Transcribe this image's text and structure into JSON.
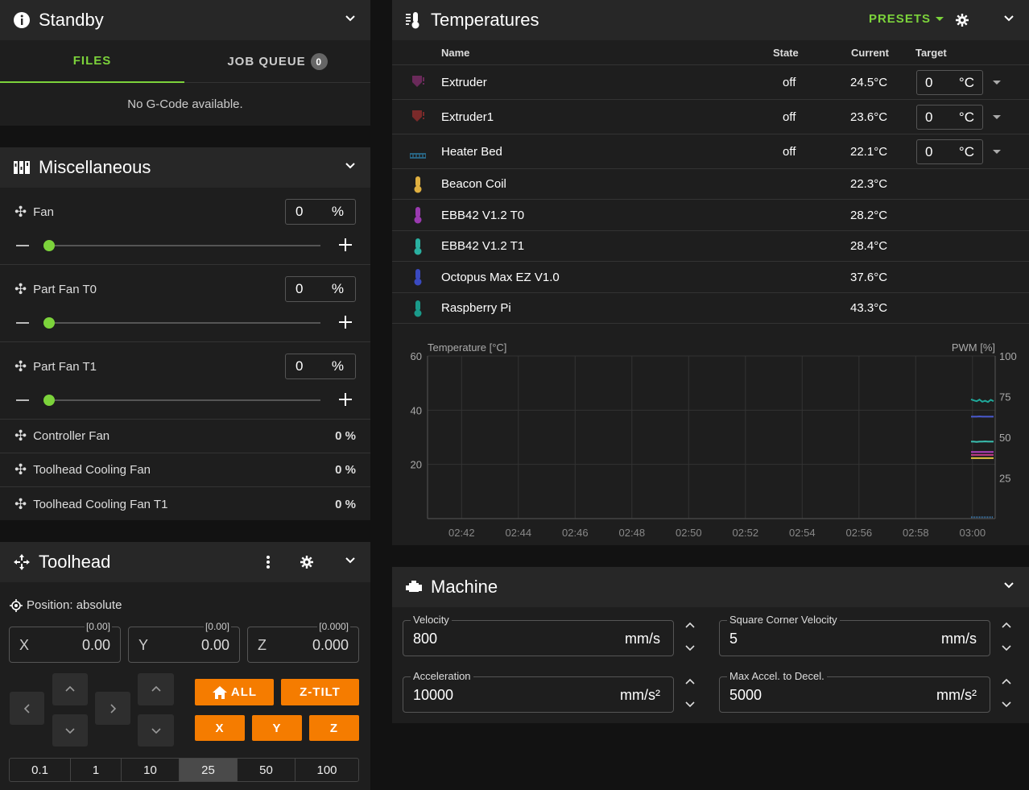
{
  "standby": {
    "title": "Standby",
    "tabs": [
      {
        "label": "FILES"
      },
      {
        "label": "JOB QUEUE",
        "badge": "0"
      }
    ],
    "empty_msg": "No G-Code available."
  },
  "misc": {
    "title": "Miscellaneous",
    "fans": [
      {
        "label": "Fan",
        "value": "0",
        "unit": "%",
        "level": 0
      },
      {
        "label": "Part Fan T0",
        "value": "0",
        "unit": "%",
        "level": 0
      },
      {
        "label": "Part Fan T1",
        "value": "0",
        "unit": "%",
        "level": 0
      }
    ],
    "status_fans": [
      {
        "label": "Controller Fan",
        "value": "0 %"
      },
      {
        "label": "Toolhead Cooling Fan",
        "value": "0 %"
      },
      {
        "label": "Toolhead Cooling Fan T1",
        "value": "0 %"
      }
    ]
  },
  "toolhead": {
    "title": "Toolhead",
    "position_label": "Position: absolute",
    "axes": [
      {
        "label": "X",
        "value": "0.00",
        "bracket": "[0.00]"
      },
      {
        "label": "Y",
        "value": "0.00",
        "bracket": "[0.00]"
      },
      {
        "label": "Z",
        "value": "0.000",
        "bracket": "[0.000]"
      }
    ],
    "home_all": "ALL",
    "z_tilt": "Z-TILT",
    "home_x": "X",
    "home_y": "Y",
    "home_z": "Z",
    "steps": [
      "0.1",
      "1",
      "10",
      "25",
      "50",
      "100"
    ],
    "selected_step": "25"
  },
  "temps": {
    "title": "Temperatures",
    "presets": "PRESETS",
    "headers": {
      "name": "Name",
      "state": "State",
      "current": "Current",
      "target": "Target"
    },
    "rows": [
      {
        "name": "Extruder",
        "state": "off",
        "current": "24.5°C",
        "target": "0",
        "unit": "°C",
        "icon": "extruder-icon",
        "color": "#6a2a5a"
      },
      {
        "name": "Extruder1",
        "state": "off",
        "current": "23.6°C",
        "target": "0",
        "unit": "°C",
        "icon": "extruder-icon",
        "color": "#7a2a2a"
      },
      {
        "name": "Heater Bed",
        "state": "off",
        "current": "22.1°C",
        "target": "0",
        "unit": "°C",
        "icon": "heater-bed-icon",
        "color": "#2a6a8a"
      },
      {
        "name": "Beacon Coil",
        "current": "22.3°C",
        "icon": "thermometer-icon",
        "color": "#e0b040"
      },
      {
        "name": "EBB42 V1.2 T0",
        "current": "28.2°C",
        "icon": "thermometer-icon",
        "color": "#9a3ab0"
      },
      {
        "name": "EBB42 V1.2 T1",
        "current": "28.4°C",
        "icon": "thermometer-icon",
        "color": "#2ab0a0"
      },
      {
        "name": "Octopus Max EZ V1.0",
        "current": "37.6°C",
        "icon": "thermometer-icon",
        "color": "#3a4ac0"
      },
      {
        "name": "Raspberry Pi",
        "current": "43.3°C",
        "icon": "thermometer-icon",
        "color": "#1a9a8a"
      }
    ]
  },
  "chart_data": {
    "type": "line",
    "ylabel": "Temperature [°C]",
    "y2label": "PWM [%]",
    "ylim": [
      0,
      60
    ],
    "y2lim": [
      0,
      100
    ],
    "yticks": [
      "60",
      "40",
      "20"
    ],
    "y2ticks": [
      "100",
      "75",
      "50",
      "25"
    ],
    "xticks": [
      "02:42",
      "02:44",
      "02:46",
      "02:48",
      "02:50",
      "02:52",
      "02:54",
      "02:56",
      "02:58",
      "03:00"
    ],
    "series": [
      {
        "name": "Raspberry Pi",
        "color": "#1fa89a",
        "values": [
          44.0,
          43.6,
          43.3,
          43.9,
          43.1,
          43.5,
          43.0,
          43.8,
          43.3
        ]
      },
      {
        "name": "Octopus Max EZ V1.0",
        "color": "#4a5ad0",
        "values": [
          37.6,
          37.6,
          37.6,
          37.7,
          37.6,
          37.6,
          37.6,
          37.6,
          37.6
        ]
      },
      {
        "name": "EBB42 V1.2 T1",
        "color": "#3ac0b0",
        "values": [
          28.4,
          28.4,
          28.3,
          28.4,
          28.4,
          28.5,
          28.4,
          28.4,
          28.4
        ]
      },
      {
        "name": "EBB42 V1.2 T0",
        "color": "#b040c0",
        "values": [
          24.6,
          24.6,
          24.6,
          24.6,
          24.6,
          24.6,
          24.6,
          24.6,
          24.6
        ]
      },
      {
        "name": "Extruder",
        "color": "#c03a8a",
        "values": [
          23.5,
          23.5,
          23.5,
          23.5,
          23.5,
          23.5,
          23.5,
          23.5,
          23.5
        ]
      },
      {
        "name": "Beacon Coil",
        "color": "#e0c040",
        "values": [
          22.3,
          22.3,
          22.3,
          22.3,
          22.3,
          22.3,
          22.3,
          22.3,
          22.3
        ]
      },
      {
        "name": "Heater Bed",
        "color": "#3a7ab0",
        "values": [
          0.5,
          0.5,
          0.5,
          0.5,
          0.5,
          0.5,
          0.5,
          0.5,
          0.5
        ]
      }
    ]
  },
  "machine": {
    "title": "Machine",
    "fields": [
      {
        "label": "Velocity",
        "value": "800",
        "unit": "mm/s"
      },
      {
        "label": "Square Corner Velocity",
        "value": "5",
        "unit": "mm/s"
      },
      {
        "label": "Acceleration",
        "value": "10000",
        "unit": "mm/s²"
      },
      {
        "label": "Max Accel. to Decel.",
        "value": "5000",
        "unit": "mm/s²"
      }
    ]
  },
  "colors": {
    "accent_green": "#7cd33b",
    "orange": "#f57c00",
    "card": "#1e1e1e",
    "header": "#272727"
  }
}
